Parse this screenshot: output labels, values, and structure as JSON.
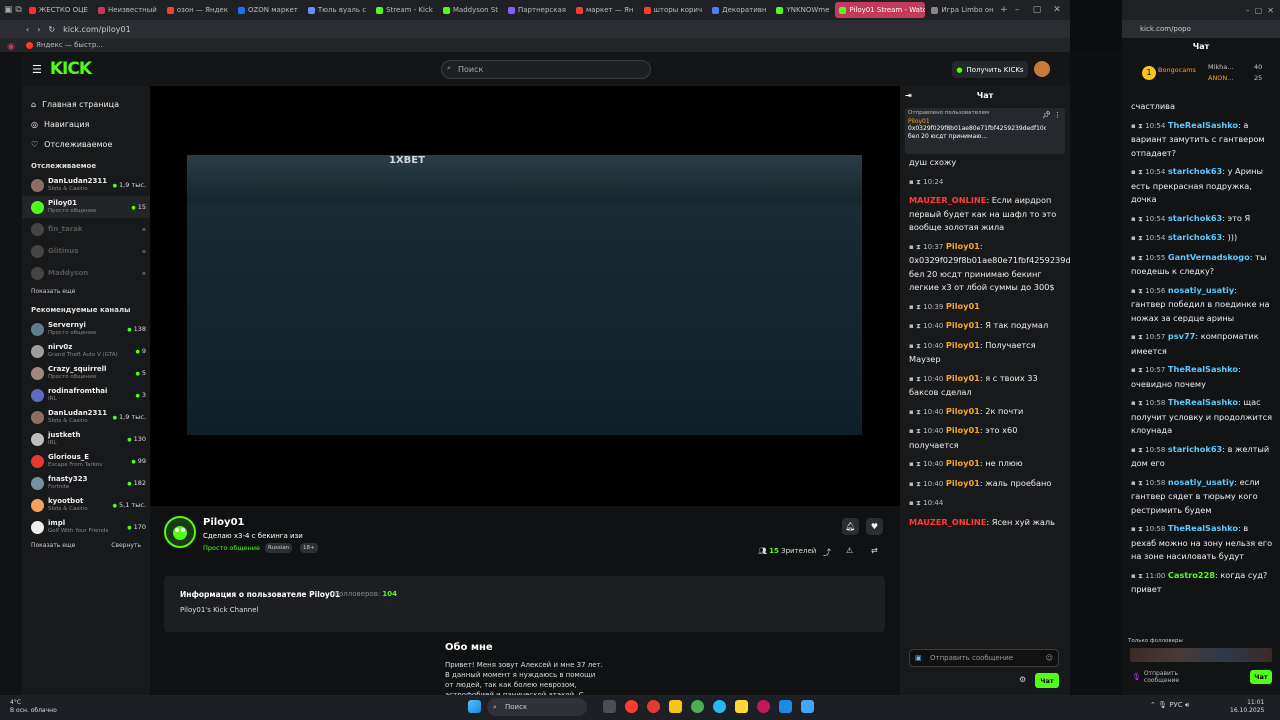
{
  "browser": {
    "tabs": [
      {
        "label": "ЖЕСТКО ОЦЕ",
        "color": "#ff2d2d"
      },
      {
        "label": "Неизвестный",
        "color": "#c23b5a"
      },
      {
        "label": "озон — Яндек",
        "color": "#ff3b30"
      },
      {
        "label": "OZON маркет",
        "color": "#1e6bff"
      },
      {
        "label": "Тюль вуаль с",
        "color": "#6b8cff"
      },
      {
        "label": "Stream - Kick",
        "color": "#53fc18"
      },
      {
        "label": "Maddyson St",
        "color": "#53fc18"
      },
      {
        "label": "Партнерская",
        "color": "#8a5cf6"
      },
      {
        "label": "маркет — Ян",
        "color": "#ff3b30"
      },
      {
        "label": "шторы корич",
        "color": "#ff3b30"
      },
      {
        "label": "Декоративн",
        "color": "#4e7bff"
      },
      {
        "label": "YNKNOWme",
        "color": "#53fc18"
      },
      {
        "label": "Piloy01 Stream - Watch L",
        "color": "#53fc18"
      },
      {
        "label": "Игра Limbo он",
        "color": "#888888"
      }
    ],
    "url": "kick.com/piloy01",
    "bookmark": "Яндекс — быстр..."
  },
  "header": {
    "logo": "KICK",
    "search_placeholder": "Поиск",
    "get_kicks": "Получить KICKs"
  },
  "sidebar": {
    "nav": [
      {
        "label": "Главная страница",
        "icon": "home-icon"
      },
      {
        "label": "Навигация",
        "icon": "compass-icon"
      },
      {
        "label": "Отслеживаемое",
        "icon": "heart-icon"
      }
    ],
    "followed_header": "Отслеживаемое",
    "followed": [
      {
        "name": "DanLudan2311",
        "cat": "Slots & Casino",
        "viewers": "1,9 тыс.",
        "color": "#8d6e63",
        "live": true
      },
      {
        "name": "Piloy01",
        "cat": "Просто общение",
        "viewers": "15",
        "color": "#53fc18",
        "live": true
      },
      {
        "name": "fin_tarak",
        "cat": "",
        "viewers": "",
        "color": "#444",
        "live": false
      },
      {
        "name": "Glitinus",
        "cat": "",
        "viewers": "",
        "color": "#444",
        "live": false
      },
      {
        "name": "Maddyson",
        "cat": "",
        "viewers": "",
        "color": "#444",
        "live": false
      }
    ],
    "show_more": "Показать еще",
    "rec_header": "Рекомендуемые каналы",
    "recommended": [
      {
        "name": "Servernyi",
        "cat": "Просто общение",
        "viewers": "138",
        "color": "#607d8b"
      },
      {
        "name": "nirv0z",
        "cat": "Grand Theft Auto V (GTA)",
        "viewers": "9",
        "color": "#9e9e9e"
      },
      {
        "name": "Crazy_squirrell",
        "cat": "Просто общение",
        "viewers": "5",
        "color": "#a1887f"
      },
      {
        "name": "rodinafromthai",
        "cat": "IRL",
        "viewers": "3",
        "color": "#5c6bc0"
      },
      {
        "name": "DanLudan2311",
        "cat": "Slots & Casino",
        "viewers": "1,9 тыс.",
        "color": "#8d6e63"
      },
      {
        "name": "justketh",
        "cat": "IRL",
        "viewers": "130",
        "color": "#bdbdbd"
      },
      {
        "name": "Glorious_E",
        "cat": "Escape From Tarkov",
        "viewers": "99",
        "color": "#e53935"
      },
      {
        "name": "fnasty323",
        "cat": "Fortnite",
        "viewers": "182",
        "color": "#78909c"
      },
      {
        "name": "kyootbot",
        "cat": "Slots & Casino",
        "viewers": "5,1 тыс.",
        "color": "#f4a261"
      },
      {
        "name": "impl",
        "cat": "Golf With Your Friends",
        "viewers": "170",
        "color": "#eeeeee"
      }
    ],
    "show_more2": "Показать еще",
    "collapse": "Свернуть"
  },
  "player": {
    "overlay_brand": "1XBET"
  },
  "stream": {
    "channel": "Piloy01",
    "title": "Сделаю x3-4 с бекинга изи",
    "category": "Просто общение",
    "tags": [
      "Russian",
      "18+"
    ],
    "viewers_count": "15",
    "viewers_label": "Зрителей"
  },
  "about": {
    "title": "Информация о пользователе Piloy01",
    "followers_label": "Фолловеров:",
    "followers_count": "104",
    "subtitle": "Piloy01's Kick Channel",
    "heading": "Обо мне",
    "text": "Привет! Меня зовут Алексей и мне 37 лет.\nВ данный момент я нуждаюсь в помощи\nот людей, так как болею неврозом,\nастрофобией и панической атакой. С"
  },
  "chat_left": {
    "title": "Чат",
    "pinned_by": "Отправлено пользователем",
    "pinned_user": "Piloy01",
    "pinned_text": "0x0329f029f8b01ae80e71fbf4259239dedf10c0ed бел 20 юсдт принимаю...",
    "messages": [
      {
        "time": "",
        "user": "",
        "color": "#fff",
        "text": "душ схожу"
      },
      {
        "time": "10:24",
        "user": "",
        "color": "#fff",
        "text": ""
      },
      {
        "time": "",
        "user": "MAUZER_ONLINE",
        "color": "#ff3b3b",
        "text": "Если аирдроп первый будет как на шафл то это вообще золотая жила"
      },
      {
        "time": "10:37",
        "user": "Piloy01",
        "color": "#f5a623",
        "text": "0x0329f029f8b01ae80e71fbf4259239dedf10c0ed бел 20 юсдт принимаю бекинг легкие x3 от лбой суммы до 300$"
      },
      {
        "time": "10:39",
        "user": "Piloy01",
        "color": "#f5a623",
        "text": ""
      },
      {
        "time": "10:40",
        "user": "Piloy01",
        "color": "#f5a623",
        "text": "Я так подумал"
      },
      {
        "time": "10:40",
        "user": "Piloy01",
        "color": "#f5a623",
        "text": "Получается Маузер"
      },
      {
        "time": "10:40",
        "user": "Piloy01",
        "color": "#f5a623",
        "text": "я с твоих 33 баксов сделал"
      },
      {
        "time": "10:40",
        "user": "Piloy01",
        "color": "#f5a623",
        "text": "2к почти"
      },
      {
        "time": "10:40",
        "user": "Piloy01",
        "color": "#f5a623",
        "text": "это x60 получается"
      },
      {
        "time": "10:40",
        "user": "Piloy01",
        "color": "#f5a623",
        "text": "не плюю"
      },
      {
        "time": "10:40",
        "user": "Piloy01",
        "color": "#f5a623",
        "text": "жаль проебано"
      },
      {
        "time": "10:44",
        "user": "",
        "color": "#fff",
        "text": ""
      },
      {
        "time": "",
        "user": "MAUZER_ONLINE",
        "color": "#ff3b3b",
        "text": "Ясен хуй жаль"
      }
    ],
    "input_placeholder": "Отправить сообщение",
    "send": "Чат"
  },
  "right_window": {
    "url": "kick.com/popo",
    "title": "Чат",
    "bongo_name": "Bongocams",
    "bongo_user1": "Mikha...",
    "bongo_val1": "40",
    "bongo_user2": "ANON...",
    "bongo_val2": "25",
    "messages": [
      {
        "time": "",
        "user": "",
        "color": "#fff",
        "text": "счастлива"
      },
      {
        "time": "10:54",
        "user": "TheRealSashko",
        "color": "#5ec8ff",
        "text": "а вариант замутить с гантвером отпадает?"
      },
      {
        "time": "10:54",
        "user": "starichok63",
        "color": "#5ec8ff",
        "text": "у Арины есть прекрасная подружка, дочка"
      },
      {
        "time": "10:54",
        "user": "starichok63",
        "color": "#5ec8ff",
        "text": "это Я"
      },
      {
        "time": "10:54",
        "user": "starichok63",
        "color": "#5ec8ff",
        "text": ")))"
      },
      {
        "time": "10:55",
        "user": "GantVernadskogo",
        "color": "#5ec8ff",
        "text": "ты поедешь к следку?"
      },
      {
        "time": "10:56",
        "user": "nosatiy_usatiy",
        "color": "#5ec8ff",
        "text": "гантвер победил в поединке на ножах за сердце арины"
      },
      {
        "time": "10:57",
        "user": "psv77",
        "color": "#5ec8ff",
        "text": "компроматик имеется"
      },
      {
        "time": "10:57",
        "user": "TheRealSashko",
        "color": "#5ec8ff",
        "text": "очевидно почему"
      },
      {
        "time": "10:58",
        "user": "TheRealSashko",
        "color": "#5ec8ff",
        "text": "щас получит условку и продолжится клоунада"
      },
      {
        "time": "10:58",
        "user": "starichok63",
        "color": "#5ec8ff",
        "text": "в желтый дом его"
      },
      {
        "time": "10:58",
        "user": "nosatiy_usatiy",
        "color": "#5ec8ff",
        "text": "если гантвер сядет в тюрьму кого рестримить будем"
      },
      {
        "time": "10:58",
        "user": "TheRealSashko",
        "color": "#5ec8ff",
        "text": "в рехаб можно на зону нельзя его на зоне насиловать будут"
      },
      {
        "time": "11:00",
        "user": "Castro228",
        "color": "#53fc18",
        "text": "когда суд? привет"
      }
    ],
    "followers_only": "Только фолловеры",
    "input_placeholder": "Отправить сообщение",
    "send": "Чат"
  },
  "taskbar": {
    "weather_temp": "4°C",
    "weather_desc": "В осн. облачно",
    "search": "Поиск",
    "lang": "РУС",
    "time": "11:01",
    "date": "16.10.2025"
  }
}
